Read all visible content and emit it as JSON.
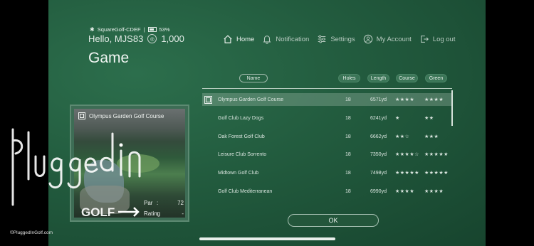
{
  "status": {
    "device": "SquareGolf-CDEF",
    "battery": "53%"
  },
  "user": {
    "greeting": "Hello, MJS83",
    "coins": "1,000"
  },
  "page_title": "Game",
  "nav": [
    {
      "label": "Home",
      "icon": "home-icon"
    },
    {
      "label": "Notification",
      "icon": "bell-icon"
    },
    {
      "label": "Settings",
      "icon": "sliders-icon"
    },
    {
      "label": "My Account",
      "icon": "user-icon"
    },
    {
      "label": "Log out",
      "icon": "logout-icon"
    }
  ],
  "columns": {
    "name": "Name",
    "holes": "Holes",
    "length": "Length",
    "course": "Course",
    "green": "Green"
  },
  "courses": [
    {
      "name": "Olympus Garden Golf Course",
      "holes": "18",
      "length": "6571yd",
      "course": "★★★★",
      "green": "★★★★",
      "selected": true
    },
    {
      "name": "Golf Club Lazy Dogs",
      "holes": "18",
      "length": "6241yd",
      "course": "★",
      "green": "★★"
    },
    {
      "name": "Oak Forest Golf Club",
      "holes": "18",
      "length": "6662yd",
      "course": "★★☆",
      "green": "★★★"
    },
    {
      "name": "Leisure Club Sorrento",
      "holes": "18",
      "length": "7350yd",
      "course": "★★★★☆",
      "green": "★★★★★"
    },
    {
      "name": "Midtown Golf Club",
      "holes": "18",
      "length": "7498yd",
      "course": "★★★★★",
      "green": "★★★★★"
    },
    {
      "name": "Golf Club Mediterranean",
      "holes": "18",
      "length": "6990yd",
      "course": "★★★★",
      "green": "★★★★"
    }
  ],
  "detail": {
    "title": "Olympus Garden Golf Course",
    "par_label": "Par",
    "par_value": "72",
    "rating_label": "Rating",
    "rating_value": "-"
  },
  "ok_label": "OK",
  "watermark": {
    "logo_text": "pluggedin",
    "logo_sub": "GOLF",
    "copyright": "©PluggedInGolf.com"
  },
  "colors": {
    "background": "#225b3e",
    "selected_row": "#8aa896",
    "ok_button": "#23563b"
  }
}
